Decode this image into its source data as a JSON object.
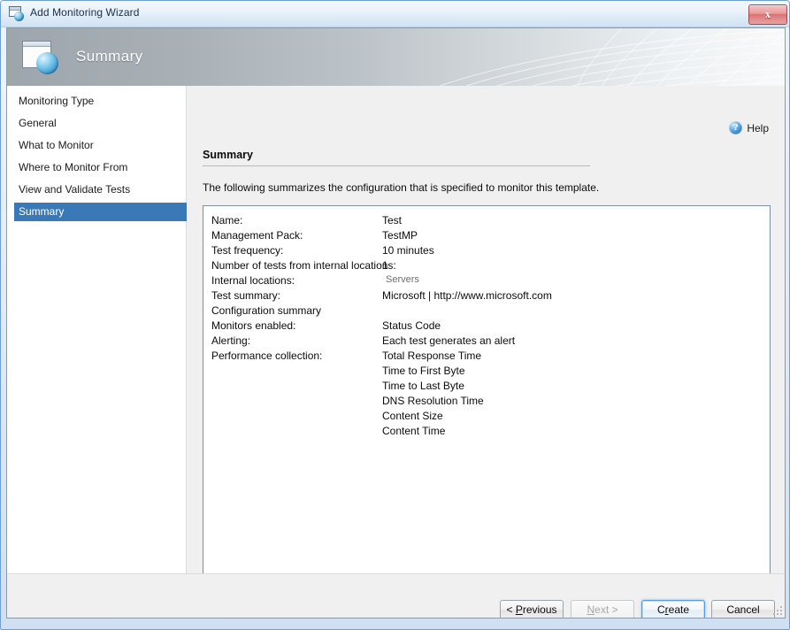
{
  "window": {
    "title": "Add Monitoring Wizard",
    "icon": "window-globe-icon",
    "close_label": "x"
  },
  "banner": {
    "title": "Summary",
    "icon": "page-globe-icon"
  },
  "sidebar": {
    "items": [
      {
        "label": "Monitoring Type",
        "selected": false
      },
      {
        "label": "General",
        "selected": false
      },
      {
        "label": "What to Monitor",
        "selected": false
      },
      {
        "label": "Where to Monitor From",
        "selected": false
      },
      {
        "label": "View and Validate Tests",
        "selected": false
      },
      {
        "label": "Summary",
        "selected": true
      }
    ]
  },
  "content": {
    "help_label": "Help",
    "help_icon": "help-circle-icon",
    "section_title": "Summary",
    "intro_text": "The following summarizes the configuration that is specified to monitor this template.",
    "rows": [
      {
        "label": "Name:",
        "value": "Test",
        "muted": false
      },
      {
        "label": "Management Pack:",
        "value": "TestMP",
        "muted": false
      },
      {
        "label": "Test frequency:",
        "value": "10 minutes",
        "muted": false
      },
      {
        "label": "Number of tests from internal locations:",
        "value": "1",
        "muted": false
      },
      {
        "label": "Internal locations:",
        "value": "Servers",
        "muted": true
      },
      {
        "label": "Test summary:",
        "value": "Microsoft | http://www.microsoft.com",
        "muted": false
      },
      {
        "label": "Configuration summary",
        "value": "",
        "muted": false
      },
      {
        "label": "Monitors enabled:",
        "value": "Status Code",
        "muted": false
      },
      {
        "label": "Alerting:",
        "value": "Each test generates an alert",
        "muted": false
      },
      {
        "label": "Performance collection:",
        "value": "Total Response Time",
        "muted": false
      },
      {
        "label": "",
        "value": "Time to First Byte",
        "muted": false
      },
      {
        "label": "",
        "value": "Time to Last Byte",
        "muted": false
      },
      {
        "label": "",
        "value": "DNS Resolution Time",
        "muted": false
      },
      {
        "label": "",
        "value": "Content Size",
        "muted": false
      },
      {
        "label": "",
        "value": "Content Time",
        "muted": false
      }
    ],
    "scrollbar": {
      "left_arrow": "scroll-left-arrow",
      "right_arrow": "scroll-right-arrow"
    }
  },
  "footer": {
    "buttons": [
      {
        "name": "previous-button",
        "prefix": "< ",
        "mnemonic": "P",
        "rest": "revious",
        "suffix": "",
        "state": "normal"
      },
      {
        "name": "next-button",
        "prefix": "",
        "mnemonic": "N",
        "rest": "ext",
        "suffix": " >",
        "state": "disabled"
      },
      {
        "name": "create-button",
        "prefix": "C",
        "mnemonic": "r",
        "rest": "eate",
        "suffix": "",
        "state": "default"
      },
      {
        "name": "cancel-button",
        "prefix": "Cancel",
        "mnemonic": "",
        "rest": "",
        "suffix": "",
        "state": "normal"
      }
    ]
  },
  "colors": {
    "accent_selected": "#3a79b8",
    "window_border": "#6f9fd0",
    "content_bg": "#f0f0f0",
    "close_button": "#d97272"
  }
}
